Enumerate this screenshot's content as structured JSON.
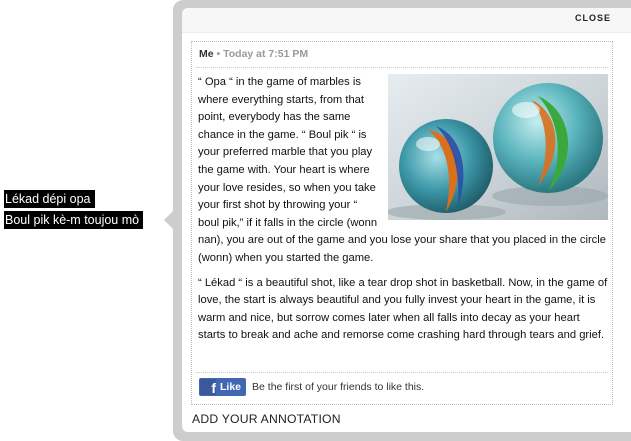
{
  "lyrics": {
    "line1": "Lékad dépi opa",
    "line2": "Boul pik kè-m toujou mò"
  },
  "popup": {
    "close_label": "CLOSE",
    "author": "Me",
    "timestamp": "• Today at 7:51 PM",
    "paragraph1": "“ Opa “ in the game of marbles is where everything starts, from that point, everybody has the same chance in the game. “ Boul pik “ is your preferred marble that you play the game with. Your heart is where your love resides, so when you take your first shot by throwing your “ boul pik,” if it falls in the circle (wonn nan), you are out of the game and you lose your share that you placed in the circle (wonn) when you started the game.",
    "paragraph2": "“ Lékad “ is a beautiful shot, like a tear drop shot in basketball. Now, in the game of love, the start is always beautiful and you fully invest your heart in the game, it is warm and nice, but sorrow comes later when all falls into decay as your heart starts to break and ache and remorse come crashing hard through tears and grief.",
    "like_label": "Like",
    "like_text": "Be the first of your friends to like this.",
    "add_annotation": "ADD YOUR ANNOTATION"
  },
  "colors": {
    "popup_border": "#cdcdcd",
    "facebook_blue": "#4267b2"
  }
}
